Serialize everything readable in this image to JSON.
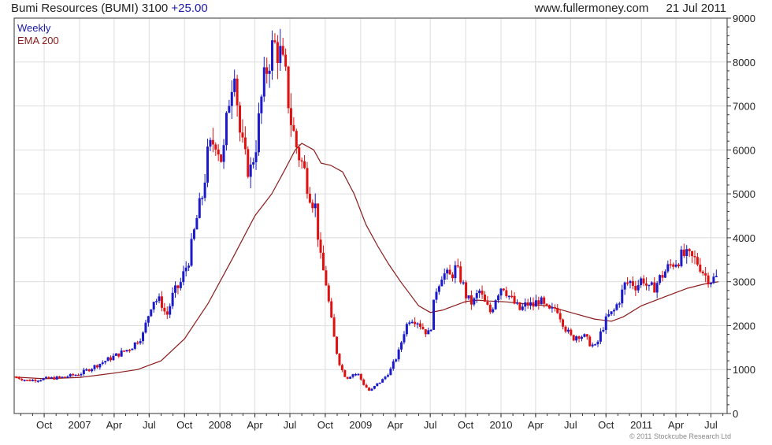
{
  "header": {
    "instrument": "Bumi Resources (BUMI)",
    "last_price": "3100",
    "change": "+25.00",
    "website": "www.fullermoney.com",
    "date": "21 Jul 2011"
  },
  "legend": {
    "series_1": "Weekly",
    "series_2": "EMA 200"
  },
  "copyright": "© 2011 Stockcube Research Ltd",
  "colors": {
    "up": "#1a1acc",
    "down": "#e01010",
    "ema": "#8b1a1a",
    "grid": "#dddddd",
    "axis": "#333333"
  },
  "chart_data": {
    "type": "candlestick",
    "xlabel": "",
    "ylabel": "",
    "ylim": [
      0,
      9000
    ],
    "y_ticks": [
      0,
      1000,
      2000,
      3000,
      4000,
      5000,
      6000,
      7000,
      8000,
      9000
    ],
    "y_axis_side": "right",
    "x_ticks": [
      "Oct",
      "2007",
      "Apr",
      "Jul",
      "Oct",
      "2008",
      "Apr",
      "Jul",
      "Oct",
      "2009",
      "Apr",
      "Jul",
      "Oct",
      "2010",
      "Apr",
      "Jul",
      "Oct",
      "2011",
      "Apr",
      "Jul"
    ],
    "x_range": [
      "2006-07-15",
      "2011-08-12"
    ],
    "grid": true,
    "legend_position": "top-left",
    "series": [
      {
        "name": "Weekly",
        "style": "candles",
        "price_path": [
          [
            "2006-07-21",
            830
          ],
          [
            "2006-08-18",
            750
          ],
          [
            "2006-10-01",
            790
          ],
          [
            "2006-11-15",
            820
          ],
          [
            "2007-01-01",
            900
          ],
          [
            "2007-02-15",
            1100
          ],
          [
            "2007-04-01",
            1300
          ],
          [
            "2007-05-15",
            1500
          ],
          [
            "2007-06-15",
            1800
          ],
          [
            "2007-07-10",
            2600
          ],
          [
            "2007-08-01",
            2550
          ],
          [
            "2007-08-15",
            2200
          ],
          [
            "2007-09-01",
            2700
          ],
          [
            "2007-09-20",
            2950
          ],
          [
            "2007-10-15",
            3600
          ],
          [
            "2007-11-01",
            4400
          ],
          [
            "2007-11-15",
            4900
          ],
          [
            "2007-12-01",
            5900
          ],
          [
            "2007-12-20",
            6300
          ],
          [
            "2008-01-08",
            5700
          ],
          [
            "2008-01-25",
            7200
          ],
          [
            "2008-02-08",
            8000
          ],
          [
            "2008-02-20",
            6500
          ],
          [
            "2008-03-05",
            5800
          ],
          [
            "2008-03-20",
            5500
          ],
          [
            "2008-04-05",
            6200
          ],
          [
            "2008-04-20",
            7300
          ],
          [
            "2008-05-05",
            8000
          ],
          [
            "2008-05-20",
            8400
          ],
          [
            "2008-06-05",
            8200
          ],
          [
            "2008-06-20",
            7600
          ],
          [
            "2008-07-05",
            6600
          ],
          [
            "2008-07-20",
            6000
          ],
          [
            "2008-08-05",
            5600
          ],
          [
            "2008-08-20",
            5100
          ],
          [
            "2008-09-05",
            4700
          ],
          [
            "2008-09-20",
            3400
          ],
          [
            "2008-10-01",
            3100
          ],
          [
            "2008-10-15",
            2200
          ],
          [
            "2008-10-28",
            1500
          ],
          [
            "2008-11-10",
            1050
          ],
          [
            "2008-11-25",
            800
          ],
          [
            "2008-12-10",
            900
          ],
          [
            "2008-12-25",
            900
          ],
          [
            "2009-01-10",
            650
          ],
          [
            "2009-01-25",
            500
          ],
          [
            "2009-02-10",
            650
          ],
          [
            "2009-03-01",
            780
          ],
          [
            "2009-03-20",
            1000
          ],
          [
            "2009-04-10",
            1400
          ],
          [
            "2009-04-25",
            1900
          ],
          [
            "2009-05-10",
            2200
          ],
          [
            "2009-05-30",
            2100
          ],
          [
            "2009-06-15",
            1900
          ],
          [
            "2009-06-30",
            1800
          ],
          [
            "2009-07-15",
            2800
          ],
          [
            "2009-08-01",
            3200
          ],
          [
            "2009-08-20",
            3100
          ],
          [
            "2009-09-05",
            3300
          ],
          [
            "2009-09-20",
            3050
          ],
          [
            "2009-10-05",
            2600
          ],
          [
            "2009-10-20",
            2500
          ],
          [
            "2009-11-05",
            2800
          ],
          [
            "2009-11-20",
            2500
          ],
          [
            "2009-12-05",
            2300
          ],
          [
            "2009-12-20",
            2700
          ],
          [
            "2010-01-05",
            2950
          ],
          [
            "2010-01-20",
            2700
          ],
          [
            "2010-02-05",
            2500
          ],
          [
            "2010-02-20",
            2350
          ],
          [
            "2010-03-10",
            2500
          ],
          [
            "2010-03-25",
            2450
          ],
          [
            "2010-04-10",
            2600
          ],
          [
            "2010-04-25",
            2400
          ],
          [
            "2010-05-10",
            2300
          ],
          [
            "2010-05-25",
            2450
          ],
          [
            "2010-06-05",
            2200
          ],
          [
            "2010-06-20",
            1900
          ],
          [
            "2010-07-05",
            1700
          ],
          [
            "2010-07-20",
            1800
          ],
          [
            "2010-08-05",
            1750
          ],
          [
            "2010-08-20",
            1600
          ],
          [
            "2010-09-05",
            1500
          ],
          [
            "2010-09-20",
            1900
          ],
          [
            "2010-10-05",
            2200
          ],
          [
            "2010-10-20",
            2300
          ],
          [
            "2010-11-05",
            2600
          ],
          [
            "2010-11-20",
            2950
          ],
          [
            "2010-12-05",
            3000
          ],
          [
            "2010-12-20",
            2900
          ],
          [
            "2011-01-05",
            3100
          ],
          [
            "2011-01-20",
            2800
          ],
          [
            "2011-02-05",
            2900
          ],
          [
            "2011-02-20",
            3100
          ],
          [
            "2011-03-05",
            3250
          ],
          [
            "2011-03-20",
            3400
          ],
          [
            "2011-04-05",
            3500
          ],
          [
            "2011-04-20",
            3600
          ],
          [
            "2011-05-05",
            3550
          ],
          [
            "2011-05-20",
            3500
          ],
          [
            "2011-06-01",
            3400
          ],
          [
            "2011-06-15",
            3150
          ],
          [
            "2011-07-01",
            3050
          ],
          [
            "2011-07-21",
            3100
          ]
        ]
      },
      {
        "name": "EMA 200",
        "style": "line",
        "points": [
          [
            "2006-07-15",
            830
          ],
          [
            "2006-10-01",
            790
          ],
          [
            "2007-01-01",
            820
          ],
          [
            "2007-04-01",
            920
          ],
          [
            "2007-06-01",
            1000
          ],
          [
            "2007-08-01",
            1200
          ],
          [
            "2007-10-01",
            1700
          ],
          [
            "2007-12-01",
            2500
          ],
          [
            "2008-02-01",
            3500
          ],
          [
            "2008-04-01",
            4500
          ],
          [
            "2008-05-15",
            5000
          ],
          [
            "2008-06-15",
            5500
          ],
          [
            "2008-07-15",
            6000
          ],
          [
            "2008-08-01",
            6150
          ],
          [
            "2008-09-01",
            6000
          ],
          [
            "2008-09-20",
            5700
          ],
          [
            "2008-10-15",
            5650
          ],
          [
            "2008-11-15",
            5500
          ],
          [
            "2008-12-15",
            5000
          ],
          [
            "2009-01-15",
            4300
          ],
          [
            "2009-02-15",
            3800
          ],
          [
            "2009-03-15",
            3400
          ],
          [
            "2009-04-15",
            3000
          ],
          [
            "2009-05-15",
            2650
          ],
          [
            "2009-06-01",
            2450
          ],
          [
            "2009-07-01",
            2300
          ],
          [
            "2009-08-01",
            2350
          ],
          [
            "2009-09-01",
            2450
          ],
          [
            "2009-10-01",
            2550
          ],
          [
            "2009-11-01",
            2580
          ],
          [
            "2009-12-01",
            2560
          ],
          [
            "2010-01-15",
            2540
          ],
          [
            "2010-03-01",
            2500
          ],
          [
            "2010-05-01",
            2450
          ],
          [
            "2010-07-01",
            2300
          ],
          [
            "2010-09-01",
            2150
          ],
          [
            "2010-10-15",
            2100
          ],
          [
            "2010-11-15",
            2200
          ],
          [
            "2011-01-01",
            2450
          ],
          [
            "2011-03-01",
            2650
          ],
          [
            "2011-05-01",
            2850
          ],
          [
            "2011-06-15",
            2950
          ],
          [
            "2011-07-21",
            3000
          ]
        ]
      }
    ]
  }
}
